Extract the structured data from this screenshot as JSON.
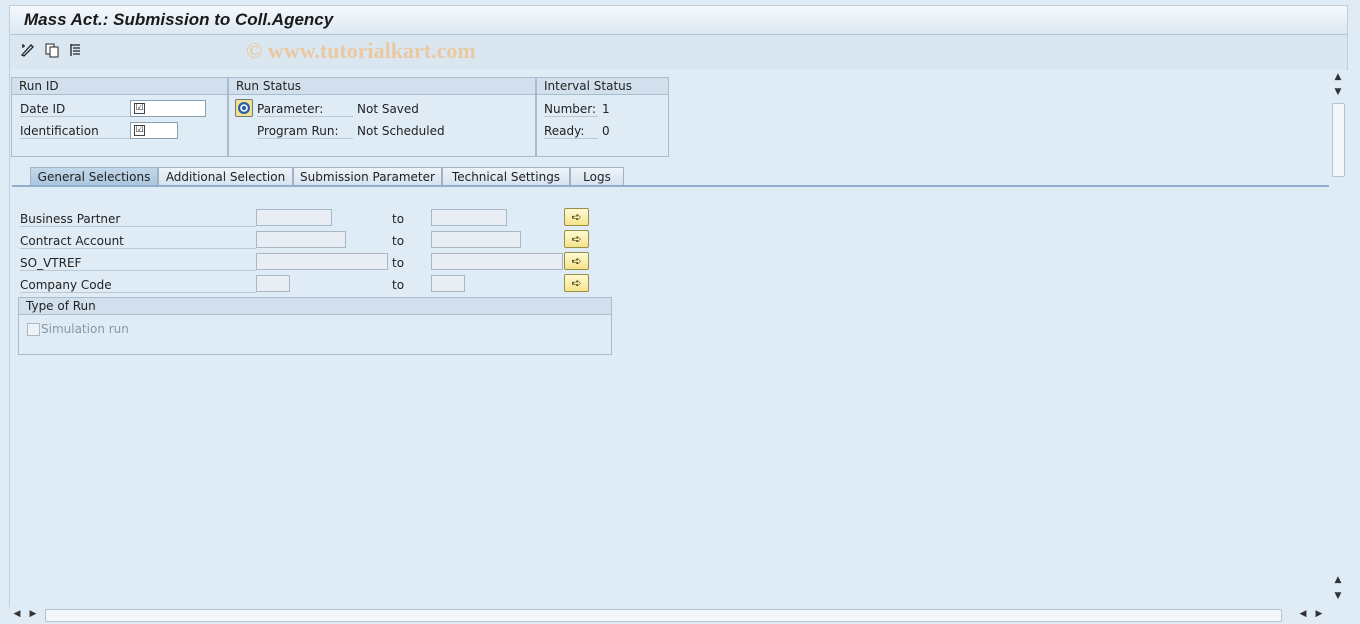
{
  "window": {
    "title": "Mass Act.: Submission to Coll.Agency"
  },
  "toolbar": {
    "icons": [
      "edit-icon",
      "copy-icon",
      "display-icon"
    ]
  },
  "watermark": "© www.tutorialkart.com",
  "run_id": {
    "header": "Run ID",
    "date_id_label": "Date ID",
    "identification_label": "Identification",
    "check_glyph": "☑"
  },
  "run_status": {
    "header": "Run Status",
    "parameter_label": "Parameter:",
    "parameter_value": "Not Saved",
    "program_run_label": "Program Run:",
    "program_run_value": "Not Scheduled"
  },
  "interval_status": {
    "header": "Interval Status",
    "number_label": "Number:",
    "number_value": "1",
    "ready_label": "Ready:",
    "ready_value": "0"
  },
  "tabs": [
    {
      "label": "General Selections",
      "active": true
    },
    {
      "label": "Additional Selection",
      "active": false
    },
    {
      "label": "Submission Parameter",
      "active": false
    },
    {
      "label": "Technical Settings",
      "active": false
    },
    {
      "label": "Logs",
      "active": false
    }
  ],
  "selections": {
    "to_label": "to",
    "rows": [
      {
        "label": "Business Partner"
      },
      {
        "label": "Contract Account"
      },
      {
        "label": "SO_VTREF"
      },
      {
        "label": "Company Code"
      }
    ]
  },
  "type_of_run": {
    "header": "Type of Run",
    "simulation_label": "Simulation run"
  },
  "colors": {
    "accent_tab": "#a9c5dd",
    "background": "#dfebf5",
    "arrow_button": "#f5e38a"
  }
}
